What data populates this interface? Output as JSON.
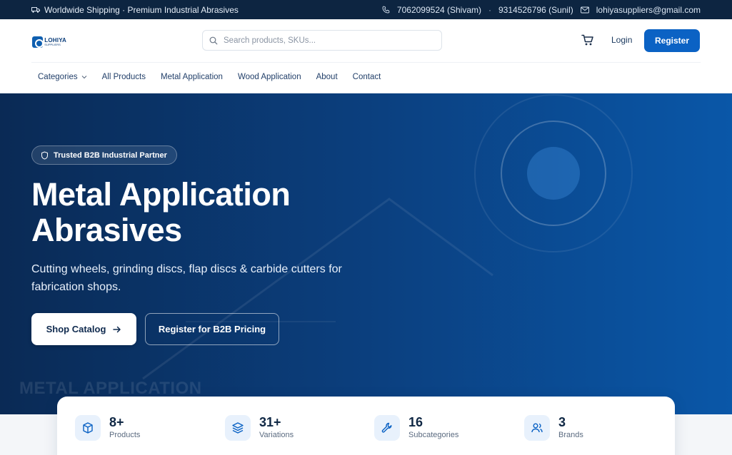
{
  "topbar": {
    "shipping": "Worldwide Shipping · Premium Industrial Abrasives",
    "phone1": "7062099524 (Shivam)",
    "separator": "·",
    "phone2": "9314526796 (Sunil)",
    "email": "lohiyasuppliers@gmail.com"
  },
  "header": {
    "logo_line1": "LOHIYA",
    "logo_line2": "SUPPLIERS",
    "search_placeholder": "Search products, SKUs...",
    "login_label": "Login",
    "register_label": "Register"
  },
  "nav": {
    "items": [
      "Categories",
      "All Products",
      "Metal Application",
      "Wood Application",
      "About",
      "Contact"
    ]
  },
  "hero": {
    "badge": "Trusted B2B Industrial Partner",
    "title_line1": "Metal Application",
    "title_line2": "Abrasives",
    "subtitle": "Cutting wheels, grinding discs, flap discs & carbide cutters for fabrication shops.",
    "primary_cta": "Shop Catalog",
    "secondary_cta": "Register for B2B Pricing",
    "watermark": "METAL APPLICATION"
  },
  "stats": [
    {
      "value": "8+",
      "label": "Products",
      "icon": "box-icon"
    },
    {
      "value": "31+",
      "label": "Variations",
      "icon": "layers-icon"
    },
    {
      "value": "16",
      "label": "Subcategories",
      "icon": "wrench-icon"
    },
    {
      "value": "3",
      "label": "Brands",
      "icon": "users-icon"
    }
  ],
  "colors": {
    "topbar": "#0d2541",
    "accent": "#0b62c4",
    "hero_start": "#0a2a55",
    "hero_end": "#0a57a8"
  }
}
